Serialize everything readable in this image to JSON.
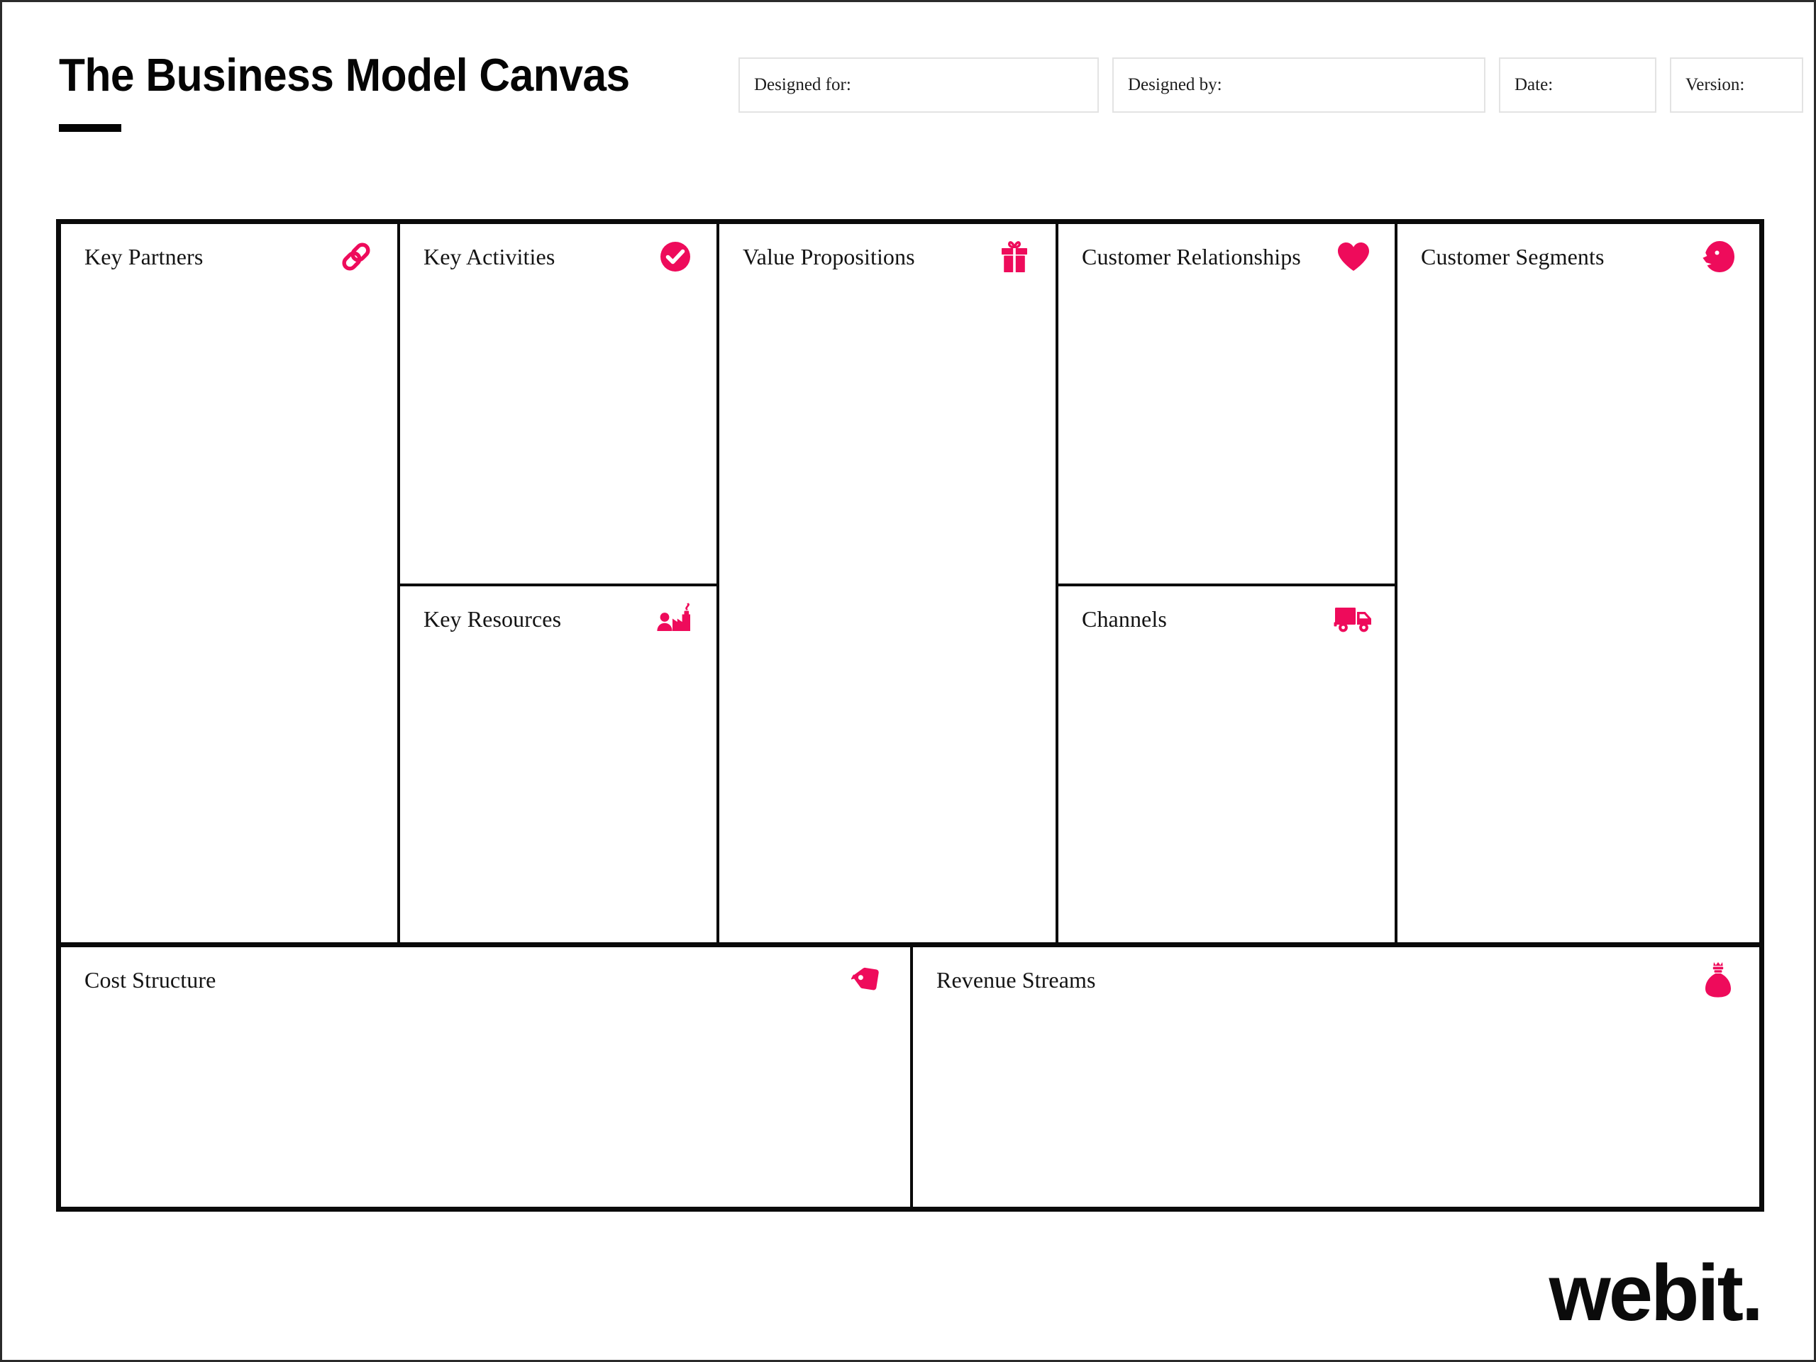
{
  "document": {
    "title": "The Business Model Canvas",
    "logo": "webit."
  },
  "theme": {
    "accent": "#EE0B5B",
    "ink": "#0A0A0A",
    "field_border": "#E3E3E3",
    "page_background": "#FFFFFF"
  },
  "header": {
    "fields": [
      {
        "label": "Designed for:",
        "value": ""
      },
      {
        "label": "Designed by:",
        "value": ""
      },
      {
        "label": "Date:",
        "value": ""
      },
      {
        "label": "Version:",
        "value": ""
      }
    ]
  },
  "canvas": {
    "blocks": [
      {
        "key": "key_partners",
        "label": "Key Partners",
        "icon": "chain-link-icon",
        "content": ""
      },
      {
        "key": "key_activities",
        "label": "Key Activities",
        "icon": "check-circle-icon",
        "content": ""
      },
      {
        "key": "key_resources",
        "label": "Key Resources",
        "icon": "factory-worker-icon",
        "content": ""
      },
      {
        "key": "value_propositions",
        "label": "Value Propositions",
        "icon": "gift-icon",
        "content": ""
      },
      {
        "key": "customer_relationships",
        "label": "Customer Relationships",
        "icon": "heart-icon",
        "content": ""
      },
      {
        "key": "channels",
        "label": "Channels",
        "icon": "delivery-truck-icon",
        "content": ""
      },
      {
        "key": "customer_segments",
        "label": "Customer Segments",
        "icon": "head-profile-icon",
        "content": ""
      },
      {
        "key": "cost_structure",
        "label": "Cost Structure",
        "icon": "price-tag-icon",
        "content": ""
      },
      {
        "key": "revenue_streams",
        "label": "Revenue Streams",
        "icon": "money-bag-icon",
        "content": ""
      }
    ]
  }
}
